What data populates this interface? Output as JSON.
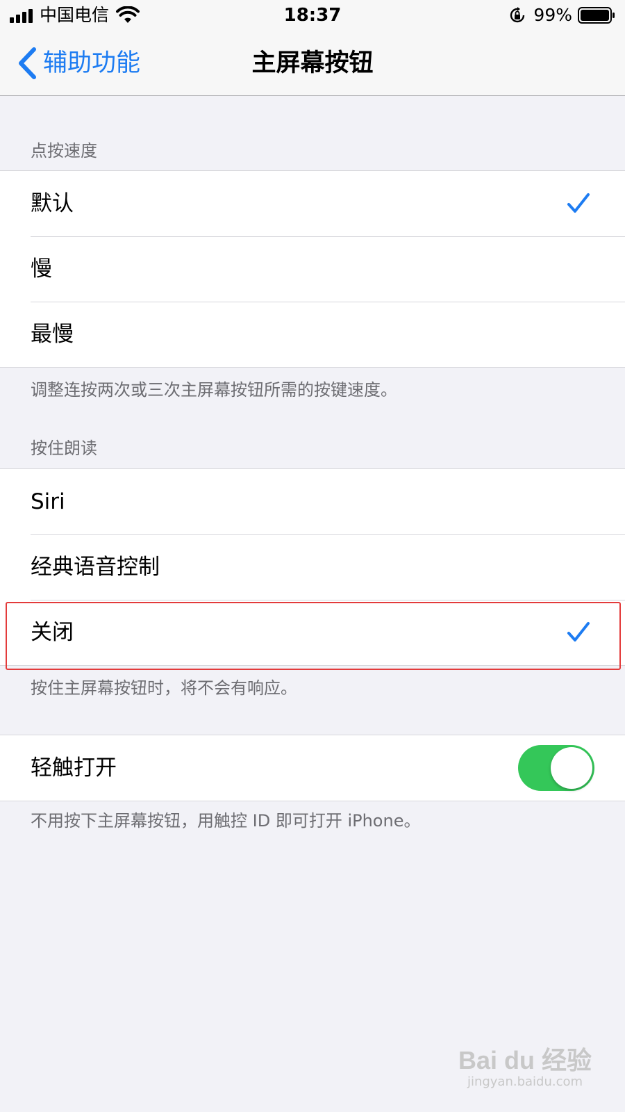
{
  "status_bar": {
    "carrier": "中国电信",
    "time": "18:37",
    "battery_percent": "99%"
  },
  "nav": {
    "back_label": "辅助功能",
    "title": "主屏幕按钮"
  },
  "click_speed": {
    "header": "点按速度",
    "options": [
      {
        "label": "默认",
        "selected": true
      },
      {
        "label": "慢",
        "selected": false
      },
      {
        "label": "最慢",
        "selected": false
      }
    ],
    "footer": "调整连按两次或三次主屏幕按钮所需的按键速度。"
  },
  "press_hold": {
    "header": "按住朗读",
    "options": [
      {
        "label": "Siri",
        "selected": false
      },
      {
        "label": "经典语音控制",
        "selected": false
      },
      {
        "label": "关闭",
        "selected": true
      }
    ],
    "footer": "按住主屏幕按钮时，将不会有响应。"
  },
  "rest_finger": {
    "label": "轻触打开",
    "enabled": true,
    "footer": "不用按下主屏幕按钮，用触控 ID 即可打开 iPhone。"
  },
  "watermark": {
    "logo": "Bai du 经验",
    "url": "jingyan.baidu.com"
  },
  "colors": {
    "accent": "#1d7cf2",
    "toggle_on": "#34c759",
    "highlight": "#e33b3b"
  }
}
